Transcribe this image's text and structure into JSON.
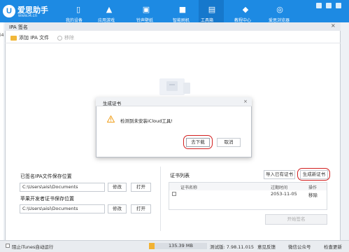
{
  "app": {
    "brand_name": "爱思助手",
    "brand_url": "www.i4.cn",
    "nav": [
      "我的设备",
      "应用游戏",
      "铃声壁纸",
      "智能刷机",
      "工具箱",
      "教程中心",
      "爱思浏览器"
    ],
    "nav_icons": [
      "phone-icon",
      "apps-icon",
      "music-icon",
      "box-icon",
      "toolbox-icon",
      "graduation-cap-icon",
      "compass-icon"
    ]
  },
  "ipa_dialog": {
    "title": "IPA 签名",
    "close": "×",
    "toolbar": {
      "add_ipa": "添加 IPA 文件",
      "remove": "移除"
    },
    "left": {
      "signed_location_label": "已签名IPA文件保存位置",
      "signed_path": "C:\\Users\\aisi\\Documents",
      "apple_cert_label": "苹果开发者证书保存位置",
      "cert_path": "C:\\Users\\aisi\\Documents",
      "modify": "修改",
      "open": "打开"
    },
    "cert_list": {
      "title": "证书列表",
      "import_existing": "导入已有证书",
      "generate_new": "生成新证书",
      "columns": [
        "证书名称",
        "过期时间",
        "操作"
      ],
      "rows": [
        {
          "name": "",
          "expires": "2053-11-05",
          "action": "移除"
        }
      ]
    },
    "start_sign": "开始签名"
  },
  "modal": {
    "title": "生成证书",
    "close": "×",
    "message": "检测到未安装iCloud工具!",
    "primary": "去下载",
    "cancel": "取消"
  },
  "left_strip_label": "i4",
  "statusbar": {
    "itunes": "阻止iTunes自动运行",
    "storage": "135.39 MB",
    "version": "测试版: 7.98.11.015",
    "feedback": "意见反馈",
    "wechat": "微信公众号",
    "update": "检查更新"
  },
  "colors": {
    "brand_blue": "#1d8ae3",
    "highlight_red": "#d21f1f",
    "warning": "#f0a01e"
  }
}
